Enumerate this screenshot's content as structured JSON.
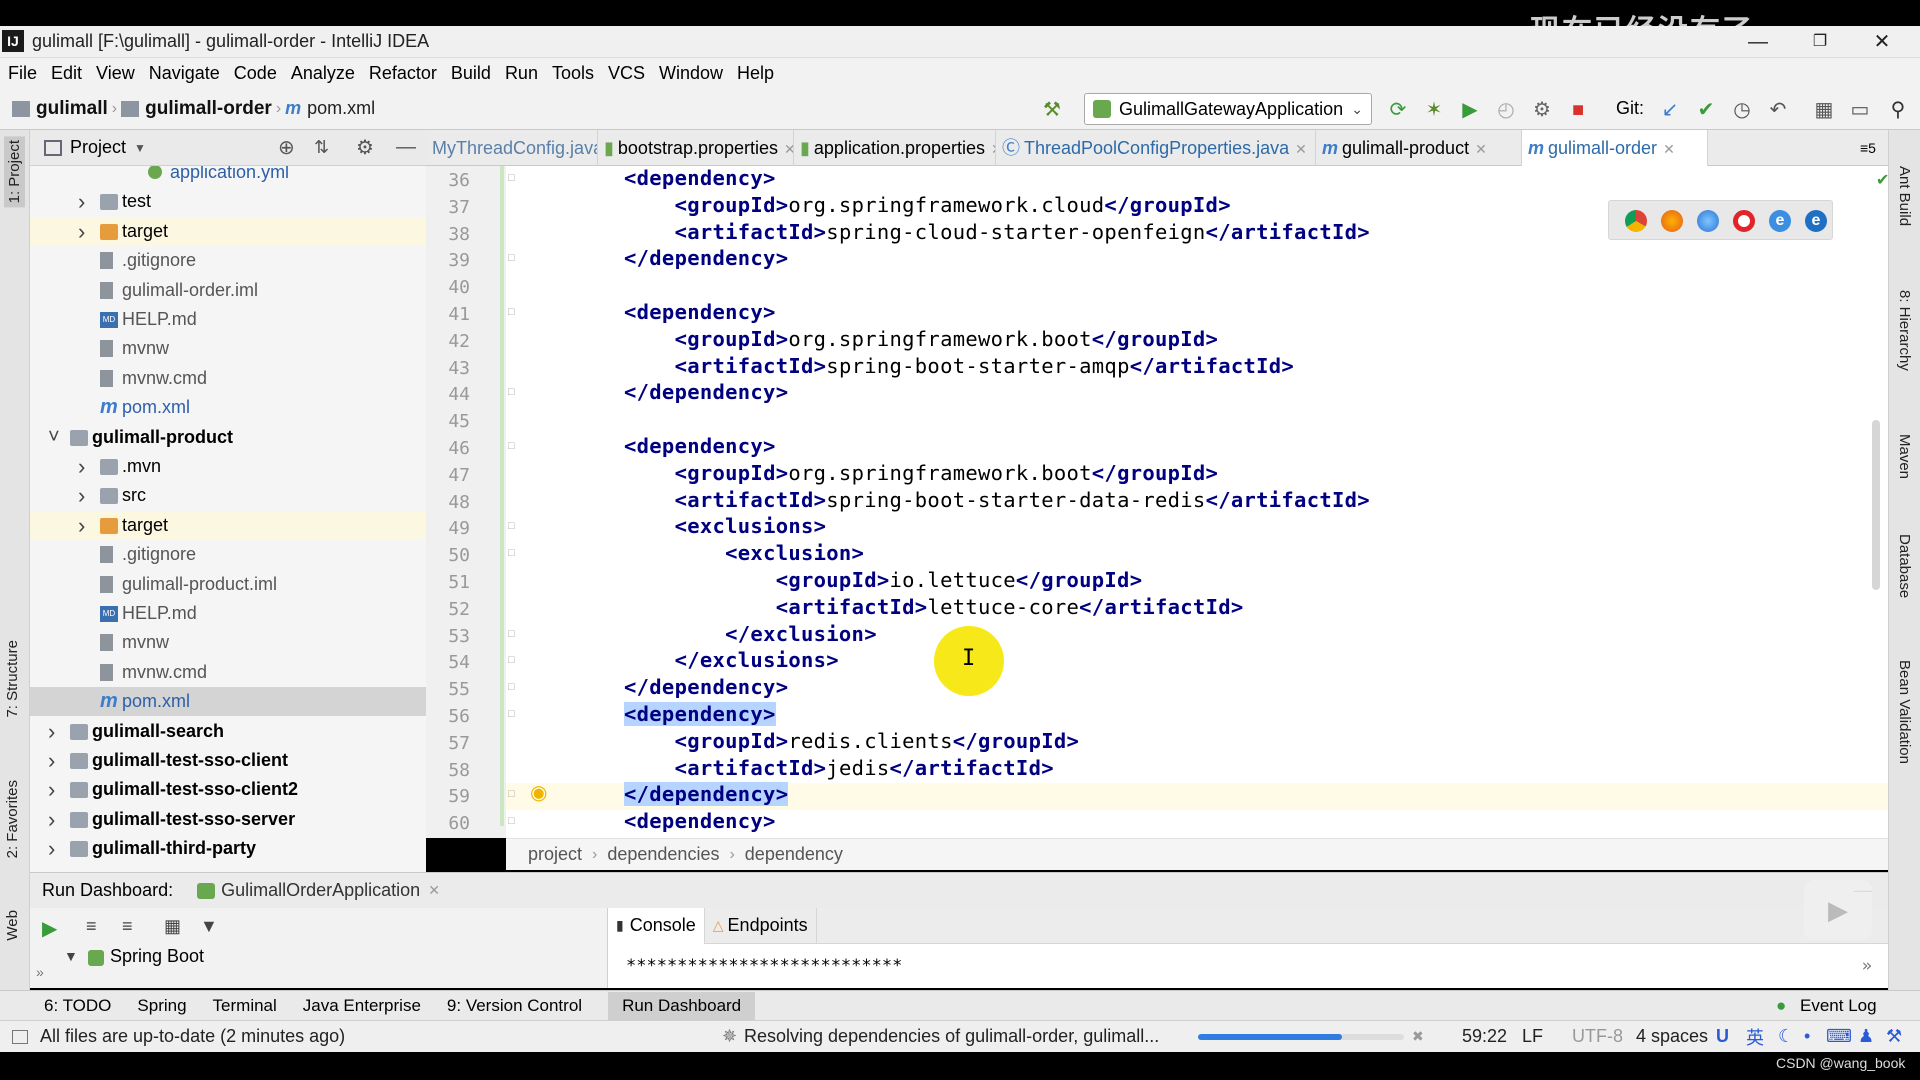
{
  "overlay": {
    "text": "现在已经没有了"
  },
  "window": {
    "title": "gulimall [F:\\gulimall] - gulimall-order - IntelliJ IDEA",
    "app_icon": "IJ"
  },
  "menu": [
    "File",
    "Edit",
    "View",
    "Navigate",
    "Code",
    "Analyze",
    "Refactor",
    "Build",
    "Run",
    "Tools",
    "VCS",
    "Window",
    "Help"
  ],
  "nav": {
    "crumbs": [
      "gulimall",
      "gulimall-order",
      "pom.xml"
    ],
    "run_config": "GulimallGatewayApplication",
    "git_label": "Git:"
  },
  "project_panel": {
    "title": "Project"
  },
  "tree": [
    {
      "label": "application.yml",
      "type": "yml"
    },
    {
      "label": "test",
      "type": "folder"
    },
    {
      "label": "target",
      "type": "folder-orange"
    },
    {
      "label": ".gitignore",
      "type": "file"
    },
    {
      "label": "gulimall-order.iml",
      "type": "file"
    },
    {
      "label": "HELP.md",
      "type": "md"
    },
    {
      "label": "mvnw",
      "type": "file"
    },
    {
      "label": "mvnw.cmd",
      "type": "file"
    },
    {
      "label": "pom.xml",
      "type": "maven"
    },
    {
      "label": "gulimall-product",
      "type": "module"
    },
    {
      "label": ".mvn",
      "type": "folder"
    },
    {
      "label": "src",
      "type": "folder"
    },
    {
      "label": "target",
      "type": "folder-orange"
    },
    {
      "label": ".gitignore",
      "type": "file"
    },
    {
      "label": "gulimall-product.iml",
      "type": "file"
    },
    {
      "label": "HELP.md",
      "type": "md"
    },
    {
      "label": "mvnw",
      "type": "file"
    },
    {
      "label": "mvnw.cmd",
      "type": "file"
    },
    {
      "label": "pom.xml",
      "type": "maven"
    },
    {
      "label": "gulimall-search",
      "type": "module"
    },
    {
      "label": "gulimall-test-sso-client",
      "type": "module"
    },
    {
      "label": "gulimall-test-sso-client2",
      "type": "module"
    },
    {
      "label": "gulimall-test-sso-server",
      "type": "module"
    },
    {
      "label": "gulimall-third-party",
      "type": "module"
    }
  ],
  "editor_tabs": [
    {
      "label": "MyThreadConfig.java"
    },
    {
      "label": "bootstrap.properties"
    },
    {
      "label": "application.properties"
    },
    {
      "label": "ThreadPoolConfigProperties.java"
    },
    {
      "label": "gulimall-product"
    },
    {
      "label": "gulimall-order",
      "active": true
    }
  ],
  "tab_overflow": "5",
  "code_lines": [
    {
      "n": "36",
      "indent": "",
      "open": "<dependency>",
      "text": "",
      "close": ""
    },
    {
      "n": "37",
      "indent": "    ",
      "open": "<groupId>",
      "text": "org.springframework.cloud",
      "close": "</groupId>"
    },
    {
      "n": "38",
      "indent": "    ",
      "open": "<artifactId>",
      "text": "spring-cloud-starter-openfeign",
      "close": "</artifactId>"
    },
    {
      "n": "39",
      "indent": "",
      "open": "</dependency>",
      "text": "",
      "close": ""
    },
    {
      "n": "40",
      "indent": "",
      "open": "",
      "text": "",
      "close": ""
    },
    {
      "n": "41",
      "indent": "",
      "open": "<dependency>",
      "text": "",
      "close": ""
    },
    {
      "n": "42",
      "indent": "    ",
      "open": "<groupId>",
      "text": "org.springframework.boot",
      "close": "</groupId>"
    },
    {
      "n": "43",
      "indent": "    ",
      "open": "<artifactId>",
      "text": "spring-boot-starter-amqp",
      "close": "</artifactId>"
    },
    {
      "n": "44",
      "indent": "",
      "open": "</dependency>",
      "text": "",
      "close": ""
    },
    {
      "n": "45",
      "indent": "",
      "open": "",
      "text": "",
      "close": ""
    },
    {
      "n": "46",
      "indent": "",
      "open": "<dependency>",
      "text": "",
      "close": ""
    },
    {
      "n": "47",
      "indent": "    ",
      "open": "<groupId>",
      "text": "org.springframework.boot",
      "close": "</groupId>"
    },
    {
      "n": "48",
      "indent": "    ",
      "open": "<artifactId>",
      "text": "spring-boot-starter-data-redis",
      "close": "</artifactId>"
    },
    {
      "n": "49",
      "indent": "    ",
      "open": "<exclusions>",
      "text": "",
      "close": ""
    },
    {
      "n": "50",
      "indent": "        ",
      "open": "<exclusion>",
      "text": "",
      "close": ""
    },
    {
      "n": "51",
      "indent": "            ",
      "open": "<groupId>",
      "text": "io.lettuce",
      "close": "</groupId>"
    },
    {
      "n": "52",
      "indent": "            ",
      "open": "<artifactId>",
      "text": "lettuce-core",
      "close": "</artifactId>"
    },
    {
      "n": "53",
      "indent": "        ",
      "open": "</exclusion>",
      "text": "",
      "close": ""
    },
    {
      "n": "54",
      "indent": "    ",
      "open": "</exclusions>",
      "text": "",
      "close": ""
    },
    {
      "n": "55",
      "indent": "",
      "open": "</dependency>",
      "text": "",
      "close": ""
    },
    {
      "n": "56",
      "indent": "",
      "open": "<dependency>",
      "text": "",
      "close": "",
      "sel": true
    },
    {
      "n": "57",
      "indent": "    ",
      "open": "<groupId>",
      "text": "redis.clients",
      "close": "</groupId>"
    },
    {
      "n": "58",
      "indent": "    ",
      "open": "<artifactId>",
      "text": "jedis",
      "close": "</artifactId>"
    },
    {
      "n": "59",
      "indent": "",
      "open": "</dependency>",
      "text": "",
      "close": "",
      "sel": true,
      "current": true
    },
    {
      "n": "60",
      "indent": "",
      "open": "<dependency>",
      "text": "",
      "close": ""
    }
  ],
  "xml_breadcrumb": [
    "project",
    "dependencies",
    "dependency"
  ],
  "run_dashboard": {
    "label": "Run Dashboard:",
    "app": "GulimallOrderApplication",
    "tree_item": "Spring Boot"
  },
  "console": {
    "tabs": [
      "Console",
      "Endpoints"
    ],
    "output": "***************************"
  },
  "tool_tabs": [
    "6: TODO",
    "Spring",
    "Terminal",
    "Java Enterprise",
    "9: Version Control",
    "Run Dashboard"
  ],
  "event_log": "Event Log",
  "status": {
    "message": "All files are up-to-date (2 minutes ago)",
    "task": "Resolving dependencies of gulimall-order, gulimall...",
    "position": "59:22",
    "line_sep": "LF",
    "encoding": "UTF-8",
    "indent": "4 spaces",
    "ime": "英",
    "progress": 0.7
  },
  "side_left": [
    "1: Project",
    "7: Structure",
    "2: Favorites",
    "Web"
  ],
  "side_right": [
    "Ant Build",
    "8: Hierarchy",
    "Maven",
    "Database",
    "Bean Validation"
  ],
  "watermark": "CSDN @wang_book"
}
